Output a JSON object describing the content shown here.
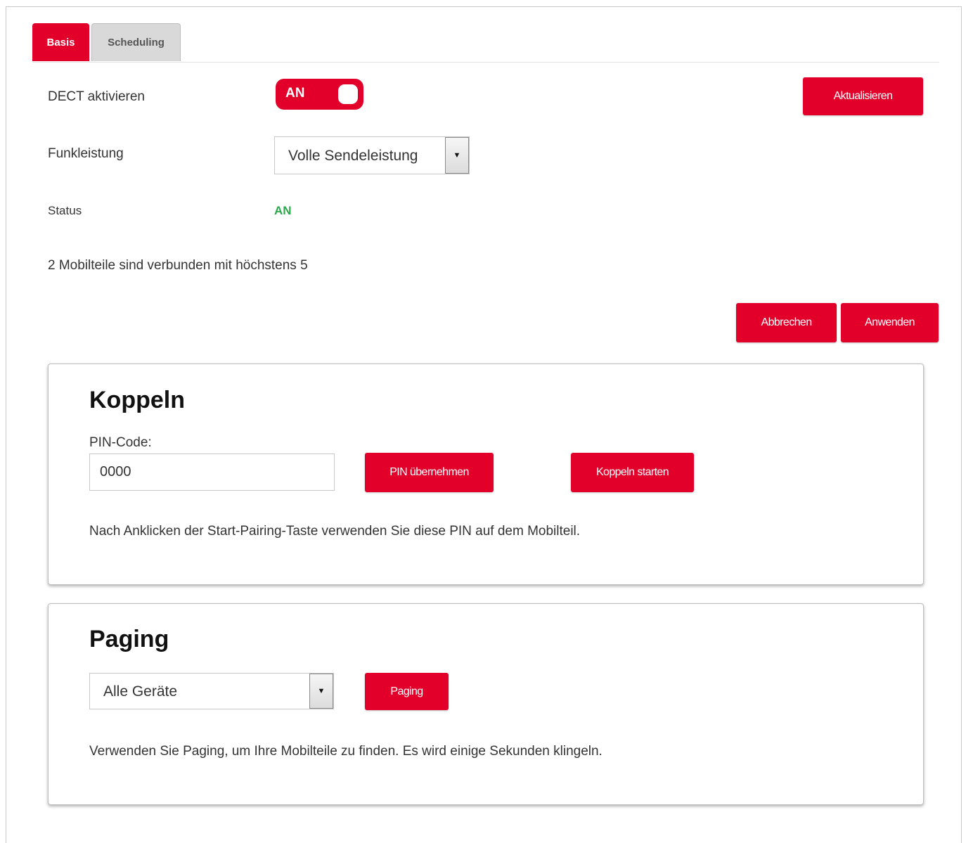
{
  "tabs": [
    {
      "label": "Basis",
      "active": true
    },
    {
      "label": "Scheduling",
      "active": false
    }
  ],
  "settings": {
    "dect_label": "DECT aktivieren",
    "toggle_text": "AN",
    "funk_label": "Funkleistung",
    "funk_value": "Volle Sendeleistung",
    "status_label": "Status",
    "status_value": "AN",
    "mobile_info": "2  Mobilteile sind verbunden mit höchstens 5",
    "refresh_button": "Aktualisieren",
    "cancel_button": "Abbrechen",
    "apply_button": "Anwenden"
  },
  "koppeln": {
    "title": "Koppeln",
    "pin_label": "PIN-Code:",
    "pin_value": "0000",
    "pin_button": "PIN übernehmen",
    "start_button": "Koppeln starten",
    "info": "Nach Anklicken der Start-Pairing-Taste verwenden Sie diese PIN auf dem Mobilteil."
  },
  "paging": {
    "title": "Paging",
    "select_value": "Alle Geräte",
    "button": "Paging",
    "info": "Verwenden Sie Paging, um Ihre Mobilteile zu finden. Es wird einige Sekunden klingeln."
  },
  "colors": {
    "accent": "#e2002b",
    "status_green": "#2aa84a"
  },
  "icons": {
    "dropdown": "chevron-down-icon"
  }
}
